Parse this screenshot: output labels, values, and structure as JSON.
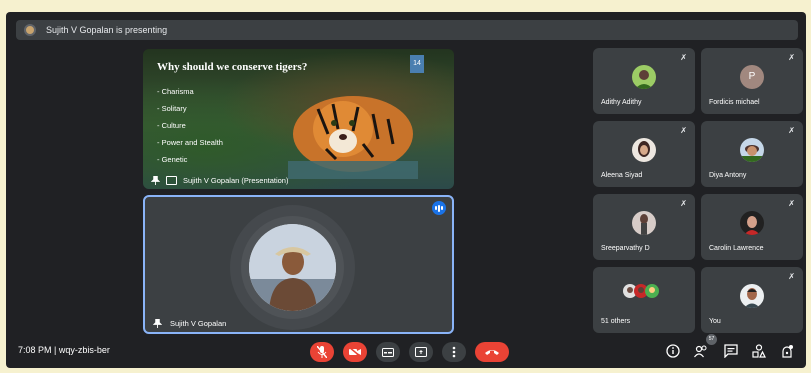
{
  "banner": {
    "text": "Sujith V Gopalan is presenting",
    "icon": "presenter-avatar-icon"
  },
  "slide": {
    "title": "Why should we conserve tigers?",
    "bullets": [
      "- Charisma",
      "- Solitary",
      "- Culture",
      "- Power and Stealth",
      "- Genetic"
    ],
    "page_badge": "14",
    "footer_label": "Sujith V Gopalan (Presentation)"
  },
  "presenter": {
    "name": "Sujith V Gopalan"
  },
  "participants": [
    {
      "name": "Adithy Adithy",
      "avatar": "photo"
    },
    {
      "name": "Fordicis michael",
      "avatar": "letter",
      "letter": "P"
    },
    {
      "name": "Aleena Siyad",
      "avatar": "photo"
    },
    {
      "name": "Diya Antony",
      "avatar": "photo"
    },
    {
      "name": "Sreeparvathy D",
      "avatar": "photo"
    },
    {
      "name": "Carolin Lawrence",
      "avatar": "photo"
    },
    {
      "name": "51 others",
      "avatar": "group"
    },
    {
      "name": "You",
      "avatar": "photo"
    }
  ],
  "bottom_bar": {
    "time_meeting": "7:08 PM  |  wqy-zbis-ber",
    "people_count": "57"
  },
  "colors": {
    "background": "#202124",
    "tile": "#3c4043",
    "accent": "#8ab4f8",
    "danger": "#ea4335"
  }
}
